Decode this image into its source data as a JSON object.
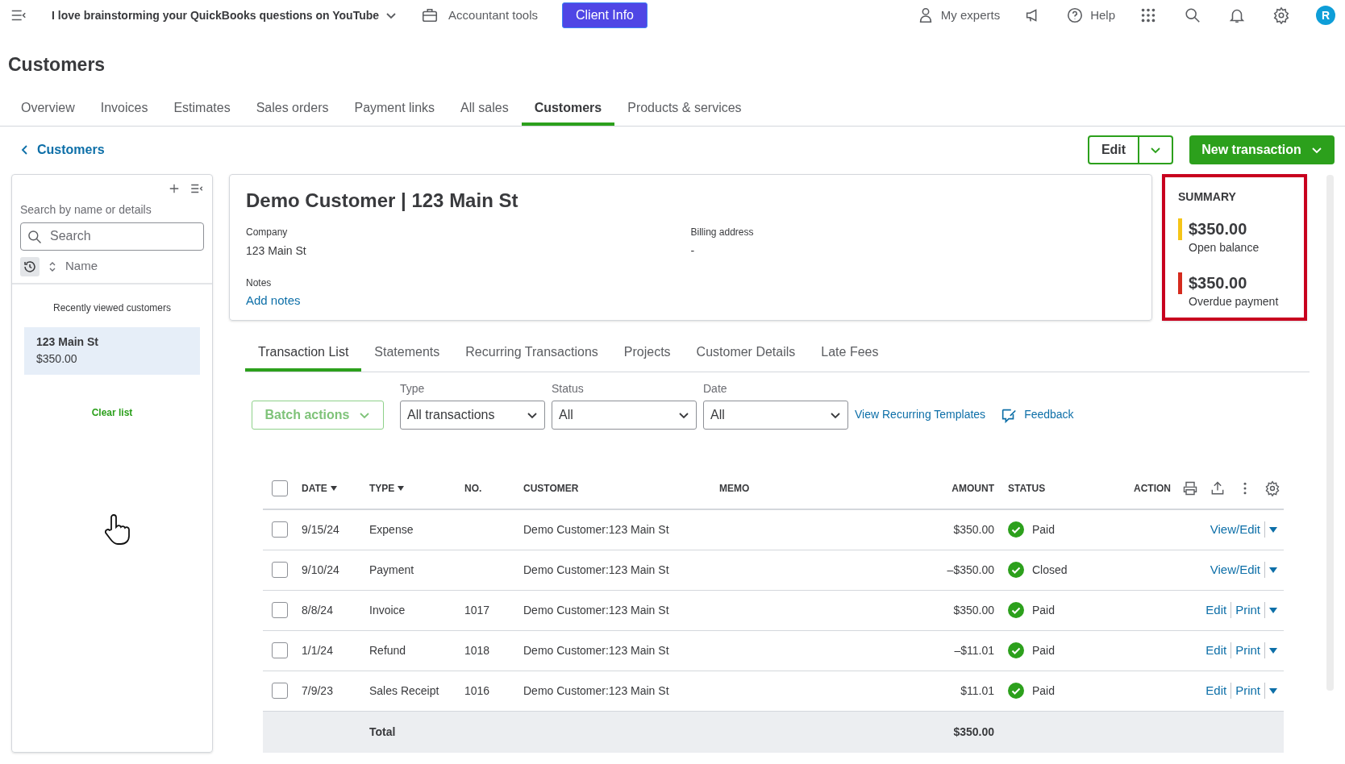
{
  "top_bar": {
    "company": "I love brainstorming your QuickBooks questions on YouTube",
    "accountant_tools": "Accountant tools",
    "client_info": "Client Info",
    "my_experts": "My experts",
    "help": "Help",
    "avatar": "R"
  },
  "page_title": "Customers",
  "nav_tabs": [
    {
      "label": "Overview",
      "selected": false
    },
    {
      "label": "Invoices",
      "selected": false
    },
    {
      "label": "Estimates",
      "selected": false
    },
    {
      "label": "Sales orders",
      "selected": false
    },
    {
      "label": "Payment links",
      "selected": false
    },
    {
      "label": "All sales",
      "selected": false
    },
    {
      "label": "Customers",
      "selected": true
    },
    {
      "label": "Products & services",
      "selected": false
    }
  ],
  "back_link": "Customers",
  "buttons": {
    "edit": "Edit",
    "new_transaction": "New transaction"
  },
  "sidebar": {
    "search_label": "Search by name or details",
    "search_placeholder": "Search",
    "sort_label": "Name",
    "recent_heading": "Recently viewed customers",
    "recent": [
      {
        "name": "123 Main St",
        "amount": "$350.00",
        "selected": true
      }
    ],
    "clear_list": "Clear list"
  },
  "customer": {
    "name": "Demo Customer | 123 Main St",
    "fields": [
      {
        "label": "Company",
        "value": "123 Main St"
      },
      {
        "label": "Billing address",
        "value": "-"
      }
    ],
    "notes_label": "Notes",
    "notes_link": "Add notes"
  },
  "summary": {
    "title": "SUMMARY",
    "items": [
      {
        "amount": "$350.00",
        "label": "Open balance",
        "color": "#f5c518"
      },
      {
        "amount": "$350.00",
        "label": "Overdue payment",
        "color": "#d52b1e"
      }
    ]
  },
  "detail_tabs": [
    {
      "label": "Transaction List",
      "selected": true
    },
    {
      "label": "Statements",
      "selected": false
    },
    {
      "label": "Recurring Transactions",
      "selected": false
    },
    {
      "label": "Projects",
      "selected": false
    },
    {
      "label": "Customer Details",
      "selected": false
    },
    {
      "label": "Late Fees",
      "selected": false
    }
  ],
  "filters": {
    "batch_actions": "Batch actions",
    "dropdowns": [
      {
        "label": "Type",
        "value": "All transactions"
      },
      {
        "label": "Status",
        "value": "All"
      },
      {
        "label": "Date",
        "value": "All"
      }
    ],
    "recurring_link": "View Recurring Templates",
    "feedback_link": "Feedback"
  },
  "table": {
    "select_all_checked": false,
    "columns": [
      {
        "label": "DATE",
        "sortable": true
      },
      {
        "label": "TYPE",
        "sortable": true
      },
      {
        "label": "NO.",
        "sortable": false
      },
      {
        "label": "CUSTOMER",
        "sortable": false
      },
      {
        "label": "MEMO",
        "sortable": false
      },
      {
        "label": "AMOUNT",
        "sortable": false
      },
      {
        "label": "STATUS",
        "sortable": false
      },
      {
        "label": "ACTION",
        "sortable": false
      }
    ],
    "rows": [
      {
        "checked": false,
        "date": "9/15/24",
        "type": "Expense",
        "no": "",
        "customer": "Demo Customer:123 Main St",
        "amount": "$350.00",
        "status": "Paid",
        "actions": [
          "View/Edit"
        ]
      },
      {
        "checked": false,
        "date": "9/10/24",
        "type": "Payment",
        "no": "",
        "customer": "Demo Customer:123 Main St",
        "amount": "–$350.00",
        "status": "Closed",
        "actions": [
          "View/Edit"
        ]
      },
      {
        "checked": false,
        "date": "8/8/24",
        "type": "Invoice",
        "no": "1017",
        "customer": "Demo Customer:123 Main St",
        "amount": "$350.00",
        "status": "Paid",
        "actions": [
          "Edit",
          "Print"
        ]
      },
      {
        "checked": false,
        "date": "1/1/24",
        "type": "Refund",
        "no": "1018",
        "customer": "Demo Customer:123 Main St",
        "amount": "–$11.01",
        "status": "Paid",
        "actions": [
          "Edit",
          "Print"
        ]
      },
      {
        "checked": false,
        "date": "7/9/23",
        "type": "Sales Receipt",
        "no": "1016",
        "customer": "Demo Customer:123 Main St",
        "amount": "$11.01",
        "status": "Paid",
        "actions": [
          "Edit",
          "Print"
        ]
      }
    ],
    "total_label": "Total",
    "total_amount": "$350.00"
  }
}
